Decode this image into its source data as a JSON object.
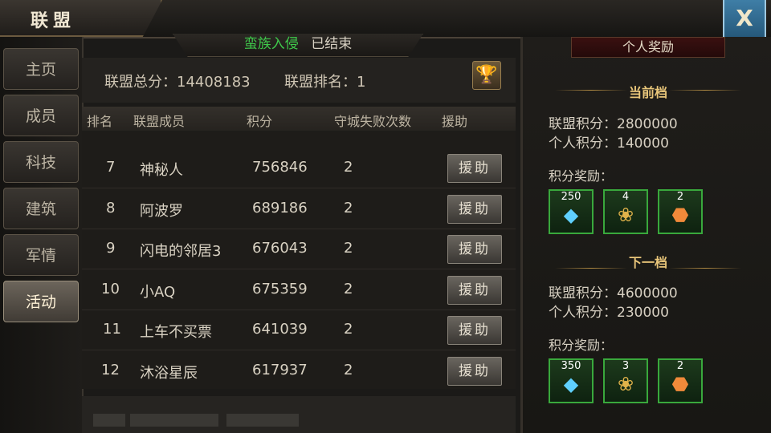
{
  "header": {
    "title": "联盟",
    "close_label": "X"
  },
  "tabs": [
    {
      "label": "主页"
    },
    {
      "label": "成员"
    },
    {
      "label": "科技"
    },
    {
      "label": "建筑"
    },
    {
      "label": "军情"
    },
    {
      "label": "活动",
      "active": true
    }
  ],
  "event": {
    "name": "蛮族入侵",
    "status": "已结束"
  },
  "summary": {
    "total_score": "联盟总分：14408183",
    "rank": "联盟排名：1"
  },
  "table": {
    "headers": [
      "排名",
      "联盟成员",
      "积分",
      "守城失败次数",
      "援助"
    ],
    "rows": [
      {
        "rank": "7",
        "name": "神秘人",
        "score": "756846",
        "fails": "2",
        "aid": "援助"
      },
      {
        "rank": "8",
        "name": "阿波罗",
        "score": "689186",
        "fails": "2",
        "aid": "援助"
      },
      {
        "rank": "9",
        "name": "闪电的邻居3",
        "score": "676043",
        "fails": "2",
        "aid": "援助"
      },
      {
        "rank": "10",
        "name": "小AQ",
        "score": "675359",
        "fails": "2",
        "aid": "援助"
      },
      {
        "rank": "11",
        "name": "上车不买票",
        "score": "641039",
        "fails": "2",
        "aid": "援助"
      },
      {
        "rank": "12",
        "name": "沐浴星辰",
        "score": "617937",
        "fails": "2",
        "aid": "援助"
      }
    ]
  },
  "rewards_panel": {
    "title": "个人奖励",
    "current": {
      "label": "当前档",
      "alliance_score": "联盟积分：2800000",
      "personal_score": "个人积分：140000",
      "reward_label": "积分奖励：",
      "items": [
        {
          "count": "250",
          "icon": "diamond-icon"
        },
        {
          "count": "4",
          "icon": "wheat-icon"
        },
        {
          "count": "2",
          "icon": "crystal-icon"
        }
      ]
    },
    "next": {
      "label": "下一档",
      "alliance_score": "联盟积分：4600000",
      "personal_score": "个人积分：230000",
      "reward_label": "积分奖励：",
      "items": [
        {
          "count": "350",
          "icon": "diamond-icon"
        },
        {
          "count": "3",
          "icon": "wheat-icon"
        },
        {
          "count": "2",
          "icon": "crystal-icon"
        }
      ]
    }
  }
}
